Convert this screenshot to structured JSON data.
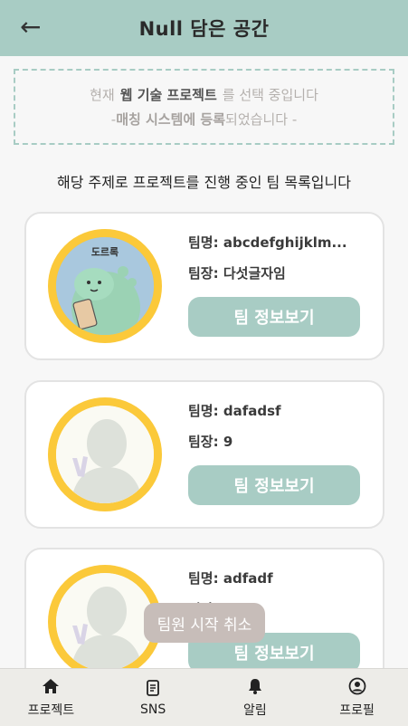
{
  "header": {
    "back_icon": "arrow-left-icon",
    "title": "Null 담은 공간"
  },
  "notice": {
    "line1_prefix": "현재",
    "project_name": "웹 기술 프로젝트",
    "line1_suffix": "를 선택 중입니다",
    "line2_prefix": "-",
    "line2_bold": "매칭 시스템에 등록",
    "line2_suffix": "되었습니다 -"
  },
  "subtitle": "해당 주제로 프로젝트를 진행 중인 팀 목록입니다",
  "labels": {
    "team_name": "팀명:",
    "leader": "팀장:",
    "info_button": "팀 정보보기"
  },
  "teams": [
    {
      "name": "abcdefghijklm...",
      "leader": "다섯글자임",
      "avatar": "dinosaur-character-avatar",
      "avatar_text": "도르록"
    },
    {
      "name": "dafadsf",
      "leader": "9",
      "avatar": "default-person-avatar"
    },
    {
      "name": "adfadf",
      "leader": "",
      "avatar": "default-person-avatar"
    }
  ],
  "toast": "팀원 시작 취소",
  "bottom_nav": [
    {
      "label": "프로젝트",
      "icon": "home-icon"
    },
    {
      "label": "SNS",
      "icon": "document-icon"
    },
    {
      "label": "알림",
      "icon": "bell-icon"
    },
    {
      "label": "프로필",
      "icon": "user-circle-icon"
    }
  ],
  "colors": {
    "accent": "#a8ccc4",
    "avatar_border": "#fbc93a",
    "toast": "#c7bdb9"
  }
}
